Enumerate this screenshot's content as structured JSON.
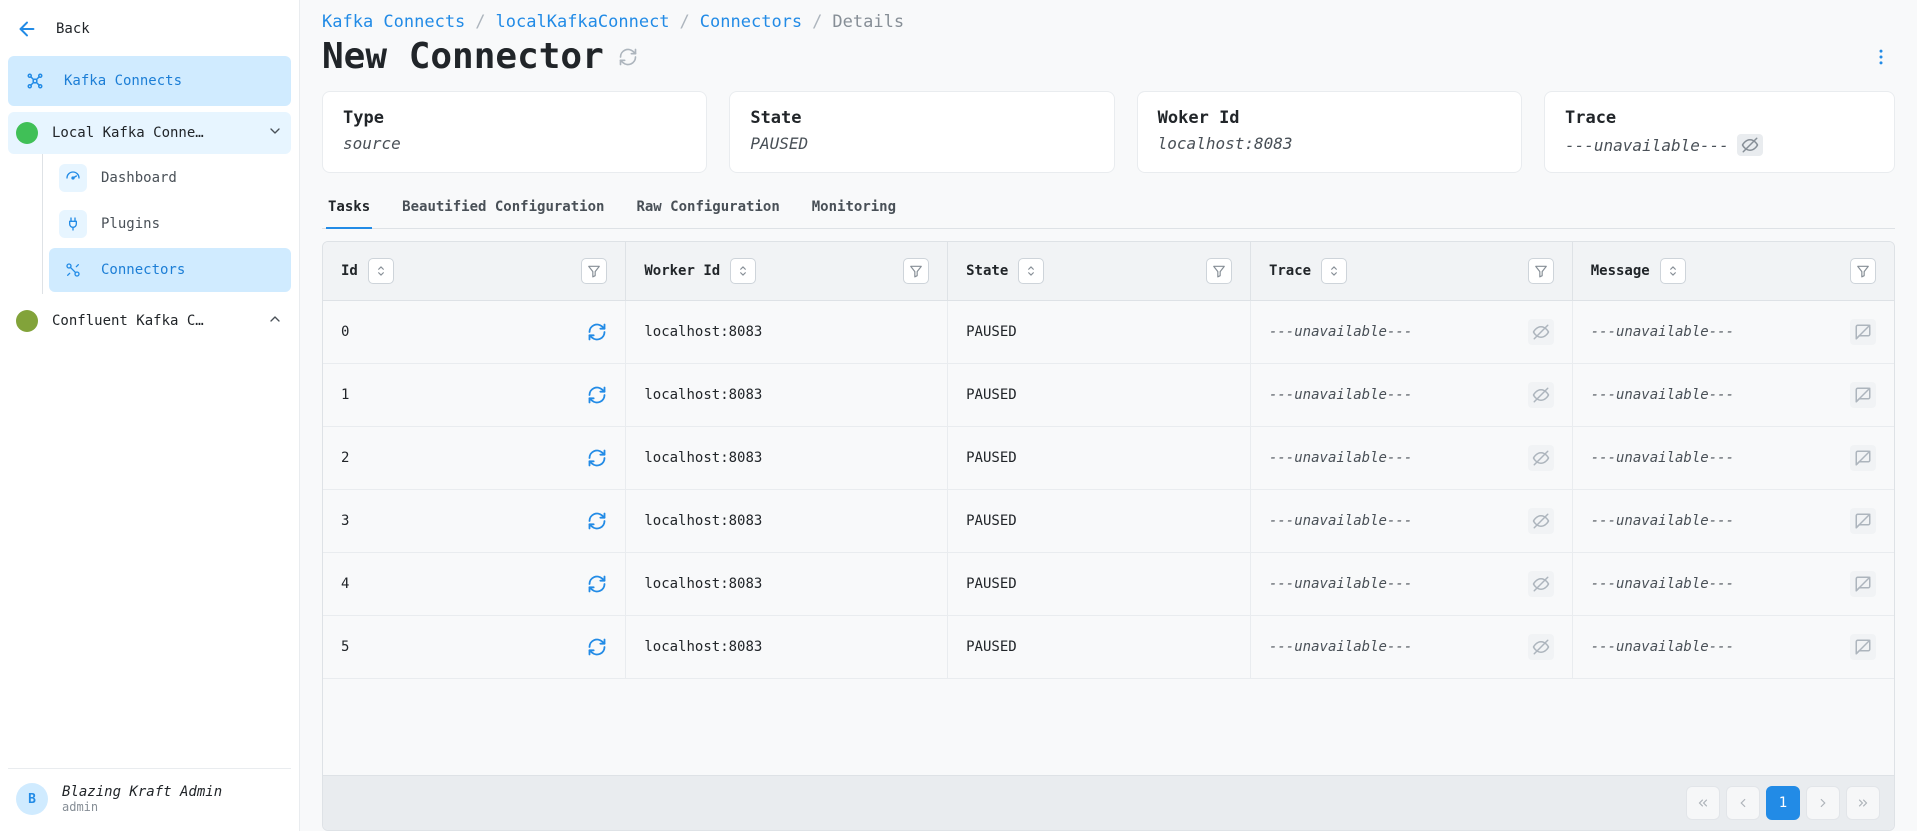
{
  "sidebar": {
    "back_label": "Back",
    "kafka_connects_label": "Kafka Connects",
    "clusters": [
      {
        "label": "Local Kafka Conne…",
        "expanded": true,
        "dot": "green"
      },
      {
        "label": "Confluent Kafka C…",
        "expanded": false,
        "dot": "olive"
      }
    ],
    "subnav": [
      {
        "label": "Dashboard",
        "icon": "gauge"
      },
      {
        "label": "Plugins",
        "icon": "plug"
      },
      {
        "label": "Connectors",
        "icon": "connector",
        "active": true
      }
    ],
    "user": {
      "initial": "B",
      "name": "Blazing Kraft Admin",
      "role": "admin"
    }
  },
  "breadcrumbs": [
    {
      "label": "Kafka Connects",
      "link": true
    },
    {
      "label": "localKafkaConnect",
      "link": true
    },
    {
      "label": "Connectors",
      "link": true
    },
    {
      "label": "Details",
      "link": false
    }
  ],
  "page_title": "New Connector",
  "cards": [
    {
      "label": "Type",
      "value": "source"
    },
    {
      "label": "State",
      "value": "PAUSED"
    },
    {
      "label": "Woker Id",
      "value": "localhost:8083"
    },
    {
      "label": "Trace",
      "value": "---unavailable---",
      "eye": true
    }
  ],
  "tabs": [
    {
      "label": "Tasks",
      "active": true
    },
    {
      "label": "Beautified Configuration"
    },
    {
      "label": "Raw Configuration"
    },
    {
      "label": "Monitoring"
    }
  ],
  "table": {
    "columns": [
      "Id",
      "Worker Id",
      "State",
      "Trace",
      "Message"
    ],
    "rows": [
      {
        "id": "0",
        "worker": "localhost:8083",
        "state": "PAUSED",
        "trace": "---unavailable---",
        "message": "---unavailable---"
      },
      {
        "id": "1",
        "worker": "localhost:8083",
        "state": "PAUSED",
        "trace": "---unavailable---",
        "message": "---unavailable---"
      },
      {
        "id": "2",
        "worker": "localhost:8083",
        "state": "PAUSED",
        "trace": "---unavailable---",
        "message": "---unavailable---"
      },
      {
        "id": "3",
        "worker": "localhost:8083",
        "state": "PAUSED",
        "trace": "---unavailable---",
        "message": "---unavailable---"
      },
      {
        "id": "4",
        "worker": "localhost:8083",
        "state": "PAUSED",
        "trace": "---unavailable---",
        "message": "---unavailable---"
      },
      {
        "id": "5",
        "worker": "localhost:8083",
        "state": "PAUSED",
        "trace": "---unavailable---",
        "message": "---unavailable---"
      }
    ]
  },
  "pagination": {
    "current": "1"
  }
}
